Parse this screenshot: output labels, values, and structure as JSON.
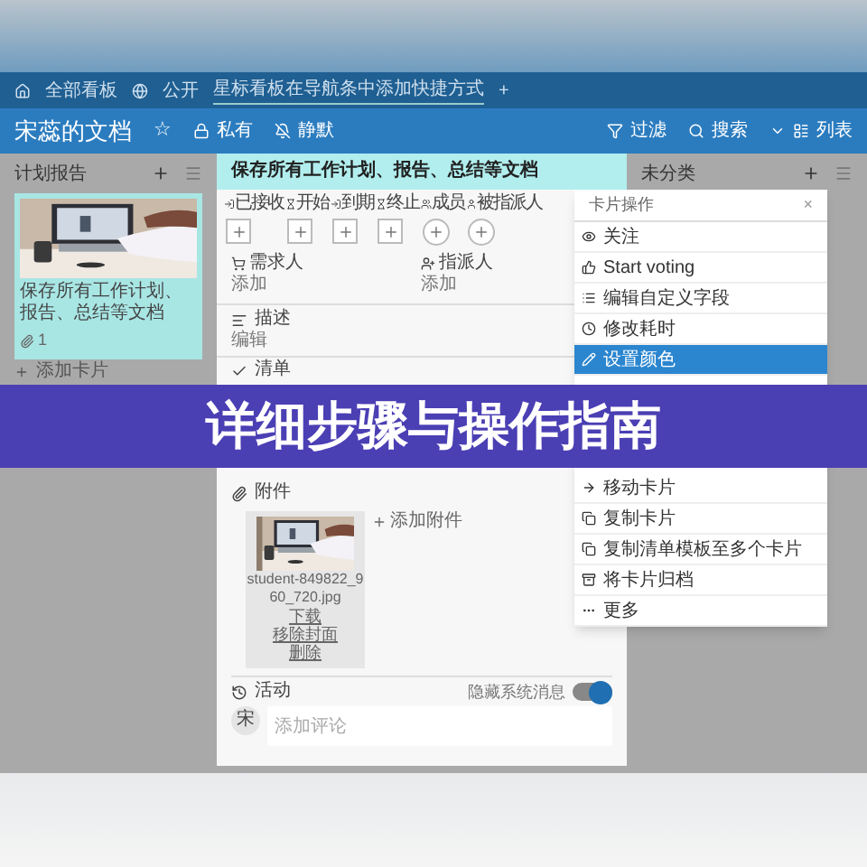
{
  "breadcrumb": {
    "home": "全部看板",
    "visibility": "公开",
    "tip": "星标看板在导航条中添加快捷方式",
    "add": "+"
  },
  "header": {
    "title": "宋蕊的文档",
    "star": "☆",
    "privacy": "私有",
    "mute": "静默",
    "actions": [
      {
        "label": "过滤",
        "kind": "filter"
      },
      {
        "label": "搜索",
        "kind": "search"
      },
      {
        "label": "列表",
        "kind": "view"
      }
    ]
  },
  "lists": [
    {
      "title": "计划报告",
      "cards": [
        {
          "kind": "picture",
          "text": "保存所有工作计划、报告、总结等文档",
          "attachments": "1"
        }
      ],
      "add_card": "添加卡片"
    },
    {
      "title": "未分类"
    }
  ],
  "card_detail": {
    "title": "保存所有工作计划、报告、总结等文档",
    "fields": [
      {
        "label": "已接收",
        "kind": "square"
      },
      {
        "label": "开始",
        "kind": "square"
      },
      {
        "label": "到期",
        "kind": "square"
      },
      {
        "label": "终止",
        "kind": "square"
      },
      {
        "label": "成员",
        "kind": "circle"
      },
      {
        "label": "被指派人",
        "kind": "circle"
      }
    ],
    "people": [
      {
        "label": "需求人",
        "action": "添加"
      },
      {
        "label": "指派人",
        "action": "添加"
      }
    ],
    "description": {
      "label": "描述",
      "action": "编辑"
    },
    "checklist": {
      "label": "清单"
    },
    "attachments": {
      "label": "附件",
      "add": "添加附件",
      "files": [
        {
          "name": "student-849822_960_720.jpg",
          "download": "下载",
          "remove_cover": "移除封面",
          "delete": "删除"
        }
      ]
    },
    "activity": {
      "label": "活动",
      "hide_system": "隐藏系统消息",
      "hide_system_on": true,
      "avatar": "宋",
      "comment_placeholder": "添加评论"
    }
  },
  "card_menu": {
    "title": "卡片操作",
    "close": "×",
    "items": [
      {
        "label": "关注",
        "kind": "eye",
        "selected": false
      },
      {
        "label": "Start voting",
        "kind": "vote",
        "selected": false
      },
      {
        "label": "编辑自定义字段",
        "kind": "list",
        "selected": false
      },
      {
        "label": "修改耗时",
        "kind": "clock",
        "selected": false
      },
      {
        "label": "设置颜色",
        "kind": "pencil",
        "selected": true
      },
      {
        "label": "移动卡片",
        "kind": "arrow",
        "selected": false
      },
      {
        "label": "复制卡片",
        "kind": "copy",
        "selected": false
      },
      {
        "label": "复制清单模板至多个卡片",
        "kind": "copylist",
        "selected": false
      },
      {
        "label": "将卡片归档",
        "kind": "archive",
        "selected": false
      },
      {
        "label": "更多",
        "kind": "more",
        "selected": false
      }
    ]
  },
  "banner": {
    "text": "详细步骤与操作指南"
  }
}
